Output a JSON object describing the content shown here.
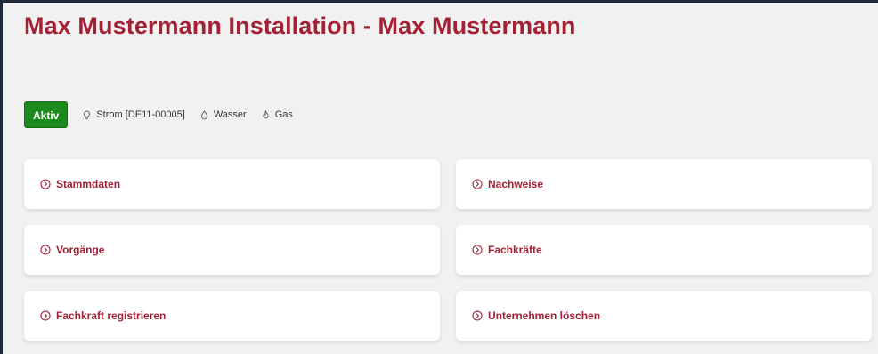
{
  "page": {
    "title": "Max Mustermann Installation - Max Mustermann"
  },
  "status": {
    "badge": "Aktiv",
    "utilities": [
      {
        "icon": "lightbulb-icon",
        "label": "Strom [DE11-00005]"
      },
      {
        "icon": "water-drop-icon",
        "label": "Wasser"
      },
      {
        "icon": "flame-icon",
        "label": "Gas"
      }
    ]
  },
  "cards": [
    {
      "label": "Stammdaten"
    },
    {
      "label": "Nachweise"
    },
    {
      "label": "Vorgänge"
    },
    {
      "label": "Fachkräfte"
    },
    {
      "label": "Fachkraft registrieren"
    },
    {
      "label": "Unternehmen löschen"
    }
  ],
  "colors": {
    "accent": "#a32035",
    "active": "#1c8a1c",
    "background": "#f1f1f1"
  }
}
